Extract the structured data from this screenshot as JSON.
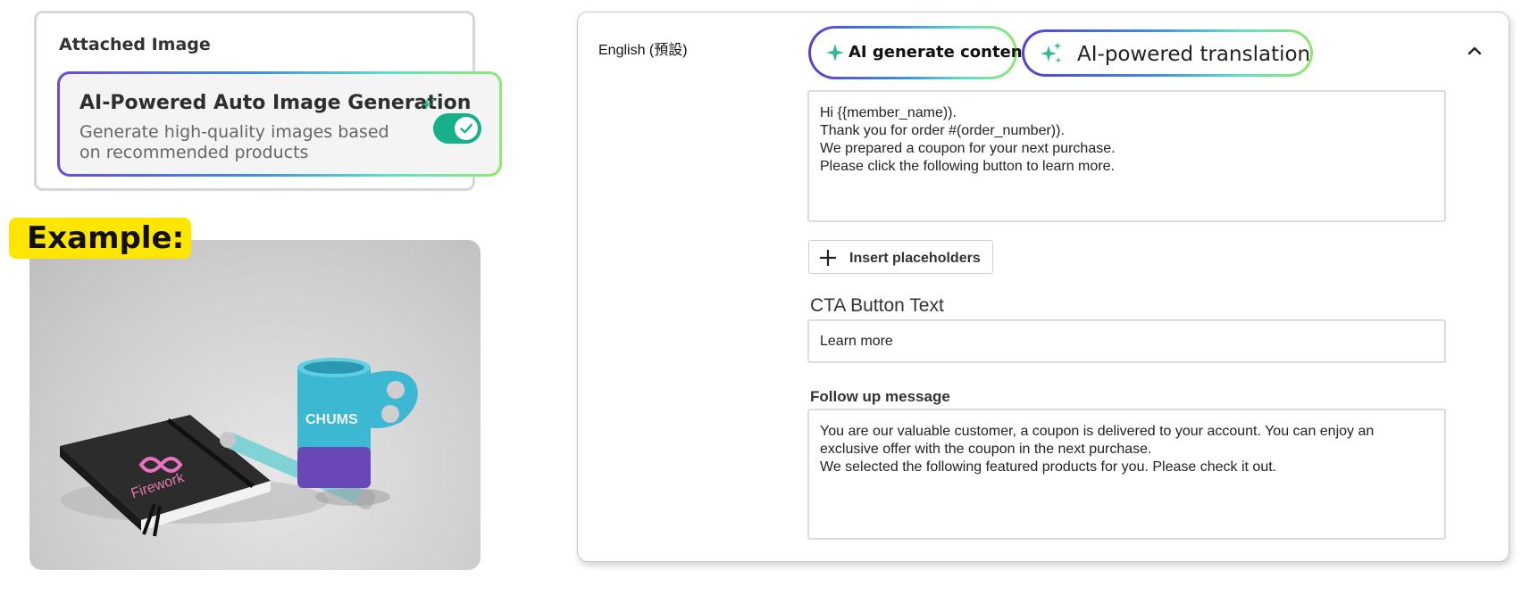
{
  "attached": {
    "title": "Attached Image",
    "feature_title": "AI-Powered Auto Image Generation",
    "feature_desc": "Generate high-quality images based on recommended products",
    "toggle_on": true
  },
  "example": {
    "label": "Example:"
  },
  "panel": {
    "language": "English (預設)",
    "ai_generate_label": "AI generate content",
    "ai_translate_label": "AI-powered translation",
    "message_body": "Hi {{member_name)).\nThank you for order #(order_number)).\nWe prepared a coupon for your next purchase.\nPlease click the following button to learn more.",
    "insert_placeholders_label": "Insert placeholders",
    "cta_label": "CTA Button Text",
    "cta_value": "Learn more",
    "follow_label": "Follow up message",
    "follow_value": "You are our valuable customer, a coupon is delivered to your account. You can enjoy an exclusive offer with the coupon in the next purchase.\nWe selected the following featured products for you. Please check it out."
  },
  "colors": {
    "toggle": "#16b08a",
    "sparkle": "#2fb89a",
    "example_bg": "#ffe600"
  }
}
